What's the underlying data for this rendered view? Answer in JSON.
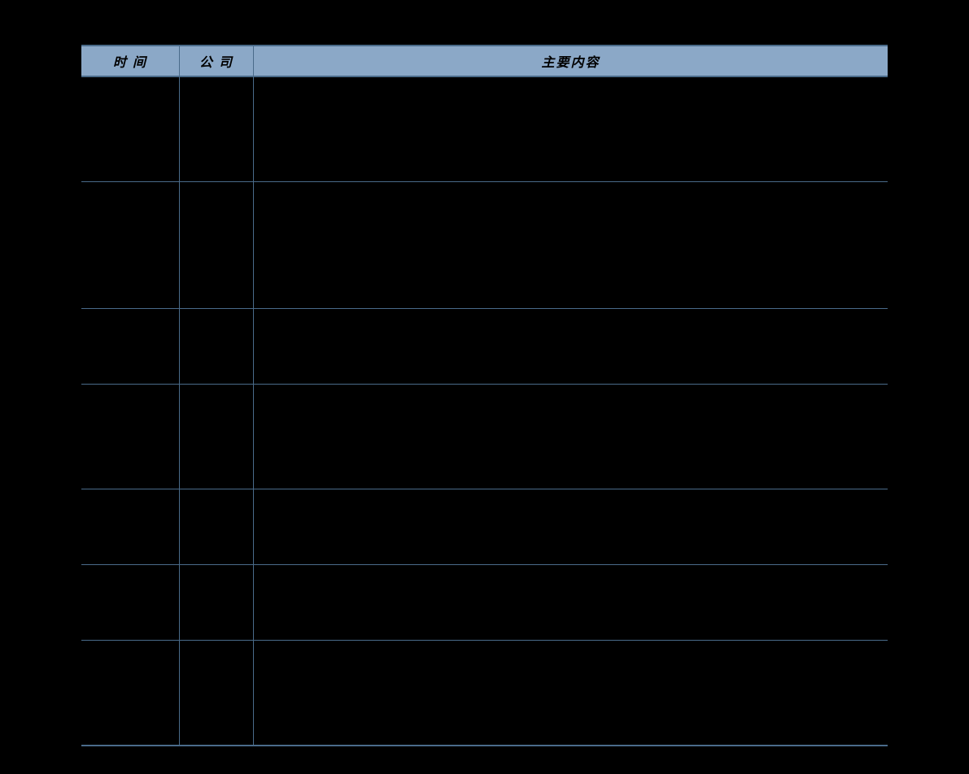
{
  "table": {
    "headers": {
      "time": "时 间",
      "company": "公 司",
      "content": "主要内容"
    },
    "rows": [
      {
        "time": "",
        "company": "",
        "content": ""
      },
      {
        "time": "",
        "company": "",
        "content": ""
      },
      {
        "time": "",
        "company": "",
        "content": ""
      },
      {
        "time": "",
        "company": "",
        "content": ""
      },
      {
        "time": "",
        "company": "",
        "content": ""
      },
      {
        "time": "",
        "company": "",
        "content": ""
      },
      {
        "time": "",
        "company": "",
        "content": ""
      }
    ]
  }
}
